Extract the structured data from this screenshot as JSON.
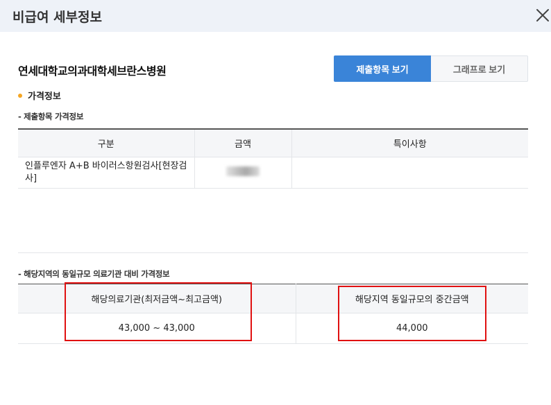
{
  "header": {
    "title": "비급여 세부정보"
  },
  "hospital": {
    "name": "연세대학교의과대학세브란스병원"
  },
  "view_buttons": {
    "primary": "제출항목 보기",
    "secondary": "그래프로 보기"
  },
  "section": {
    "title": "가격정보"
  },
  "submitted": {
    "subtitle": "- 제출항목 가격정보",
    "columns": [
      "구분",
      "금액",
      "특이사항"
    ],
    "row": {
      "item": "인플루엔자 A+B 바이러스항원검사[현장검사]",
      "amount": "",
      "note": ""
    }
  },
  "regional": {
    "subtitle": "- 해당지역의 동일규모 의료기관 대비 가격정보",
    "columns": [
      "해당의료기관(최저금액~최고금액)",
      "해당지역 동일규모의 중간금액"
    ],
    "values": [
      "43,000 ~ 43,000",
      "44,000"
    ]
  },
  "colors": {
    "accent": "#3a84d8",
    "dot": "#f5a623",
    "highlight": "#e01010"
  }
}
